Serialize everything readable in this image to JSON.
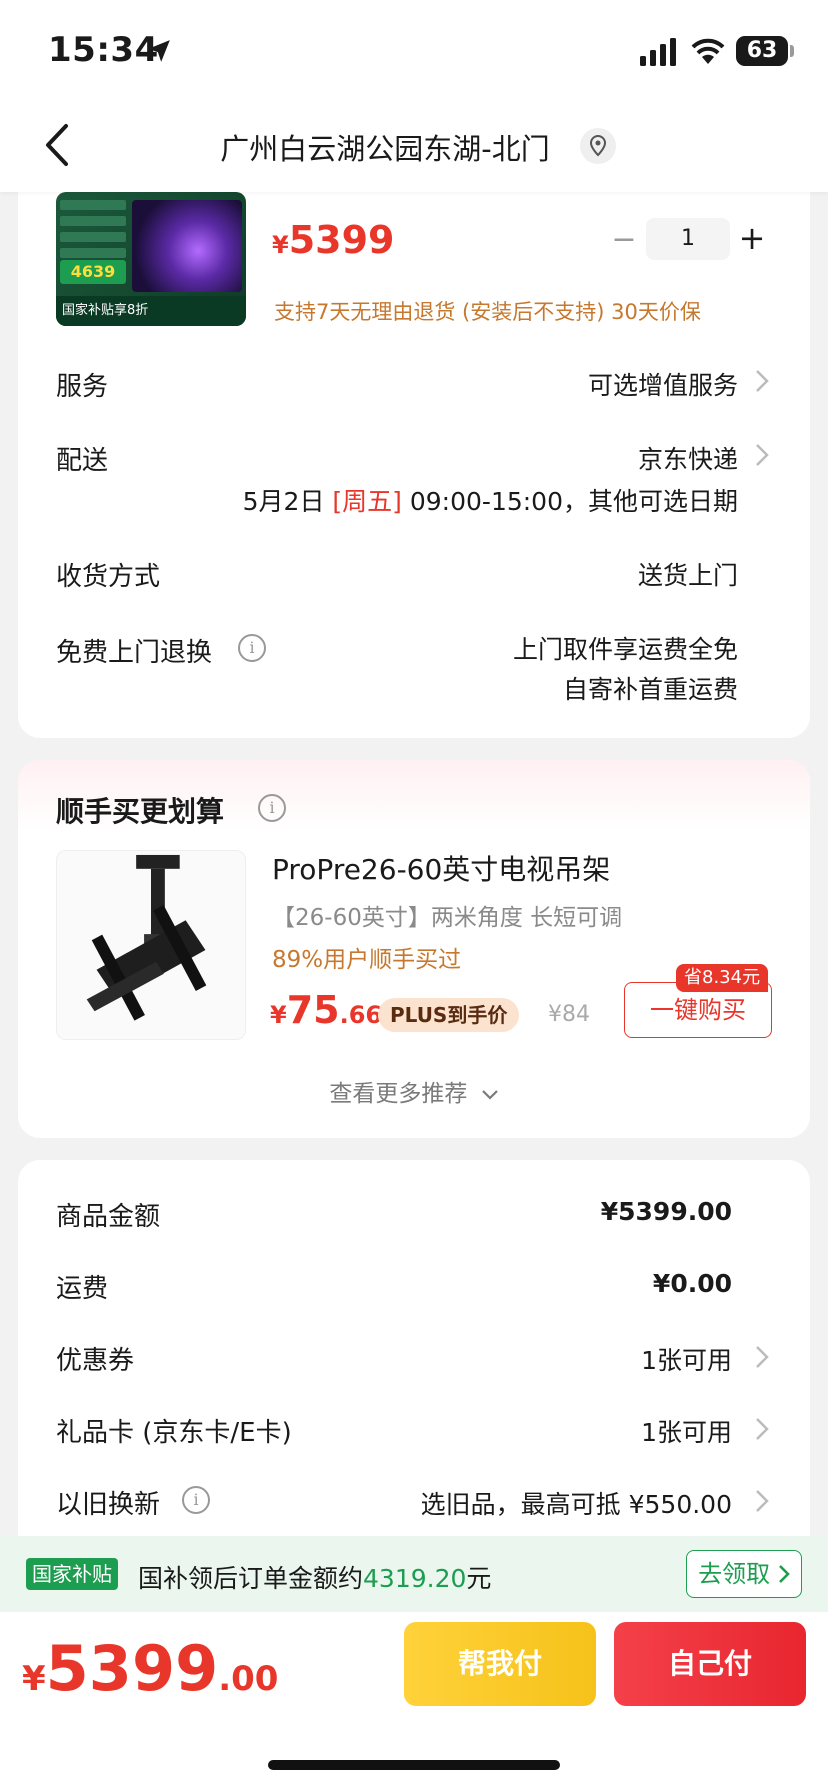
{
  "status_bar": {
    "time": "15:34",
    "battery": "63"
  },
  "header": {
    "title": "广州白云湖公园东湖-北门"
  },
  "product": {
    "thumb_badge": "4639",
    "thumb_bottom": "国家补贴享8折",
    "price_symbol": "¥",
    "price": "5399",
    "quantity": "1",
    "qty_minus": "−",
    "qty_plus": "+",
    "return_note": "支持7天无理由退货 (安装后不支持)   30天价保"
  },
  "rows": {
    "service": {
      "label": "服务",
      "value": "可选增值服务"
    },
    "delivery": {
      "label": "配送",
      "value": "京东快递",
      "date": "5月2日",
      "weekday": "[周五]",
      "time": "09:00-15:00，其他可选日期"
    },
    "receive": {
      "label": "收货方式",
      "value": "送货上门"
    },
    "free_return": {
      "label": "免费上门退换",
      "value_line1": "上门取件享运费全免",
      "value_line2": "自寄补首重运费"
    }
  },
  "addon": {
    "title": "顺手买更划算",
    "name": "ProPre26-60英寸电视吊架",
    "subtitle": "【26-60英寸】两米角度 长短可调",
    "percent": "89%用户顺手买过",
    "price_symbol": "¥",
    "price_int": "75",
    "price_dec": ".66",
    "plus_tag": "PLUS到手价",
    "orig_price": "¥84",
    "save_badge": "省8.34元",
    "buy_label": "一键购买",
    "more": "查看更多推荐"
  },
  "summary": {
    "goods": {
      "label": "商品金额",
      "value": "¥5399.00"
    },
    "shipping": {
      "label": "运费",
      "value": "¥0.00"
    },
    "coupon": {
      "label": "优惠券",
      "value": "1张可用"
    },
    "giftcard": {
      "label": "礼品卡 (京东卡/E卡)",
      "value": "1张可用"
    },
    "tradein": {
      "label": "以旧换新",
      "value": "选旧品，最高可抵 ¥550.00"
    }
  },
  "subsidy": {
    "tag": "国家补贴",
    "text_prefix": "国补领后订单金额约",
    "amount": "4319.20",
    "text_suffix": "元",
    "button": "去领取"
  },
  "footer": {
    "symbol": "¥",
    "total_int": "5399",
    "total_dec": ".00",
    "help_pay": "帮我付",
    "self_pay": "自己付"
  },
  "colors": {
    "accent_red": "#e8362a",
    "green": "#1d9d4f",
    "orange": "#c6782e"
  }
}
